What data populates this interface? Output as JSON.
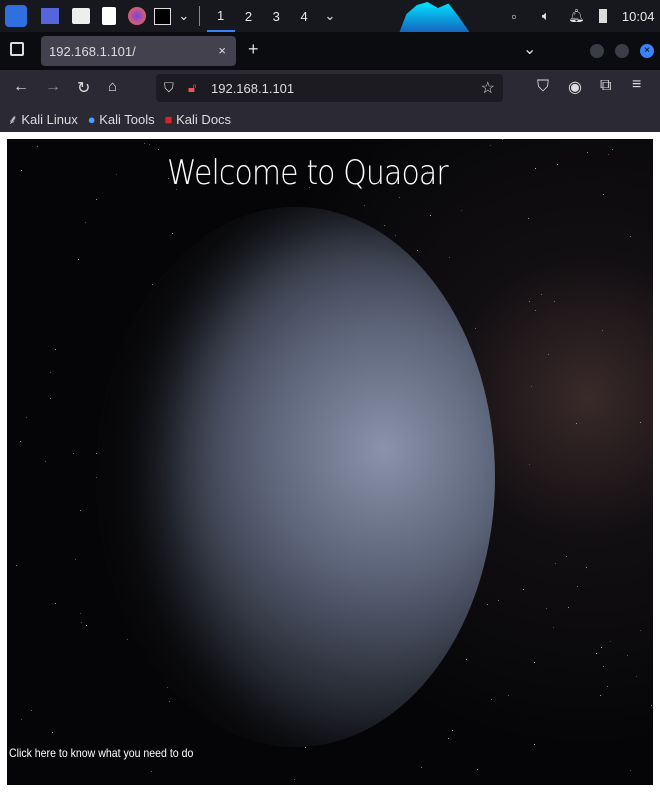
{
  "taskbar": {
    "workspaces": [
      "1",
      "2",
      "3",
      "4"
    ],
    "active_workspace": "1",
    "clock": "10:04"
  },
  "browser": {
    "tab_title": "192.168.1.101/",
    "url": "192.168.1.101",
    "bookmarks": [
      "Kali Linux",
      "Kali Tools",
      "Kali Docs"
    ]
  },
  "page": {
    "heading": "Welcome to Quaoar",
    "link": "Click here to know what you need to do"
  },
  "colors": {
    "accent": "#3b82f6",
    "page_bg": "#050507"
  }
}
